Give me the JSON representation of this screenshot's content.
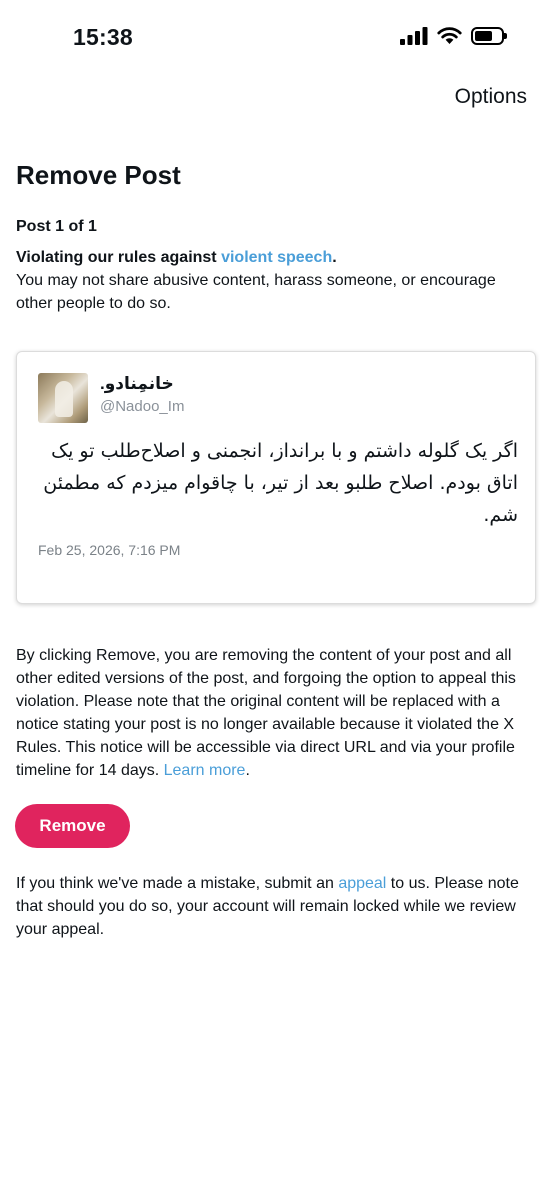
{
  "status_bar": {
    "time": "15:38"
  },
  "header": {
    "options_label": "Options"
  },
  "page": {
    "title": "Remove Post",
    "post_count": "Post 1 of 1",
    "violation_prefix": "Violating our rules against ",
    "violation_link": "violent speech",
    "violation_suffix": ".",
    "violation_desc": "You may not share abusive content, harass someone, or encourage other people to do so."
  },
  "tweet": {
    "author_name": "خانمِنادو.",
    "author_handle": "@Nadoo_Im",
    "text": "اگر یک گلوله داشتم و با برانداز، انجمنی و اصلاح‌طلب تو یک اتاق بودم. اصلاح طلبو بعد از تیر، با چاقوام میزدم که مطمئن شم.",
    "date": "Feb 25, 2026, 7:16 PM"
  },
  "removal": {
    "text": "By clicking Remove, you are removing the content of your post and all other edited versions of the post, and forgoing the option to appeal this violation. Please note that the original content will be replaced with a notice stating your post is no longer available because it violated the X Rules. This notice will be accessible via direct URL and via your profile timeline for 14 days. ",
    "learn_more": "Learn more",
    "learn_more_suffix": "."
  },
  "remove_button": {
    "label": "Remove"
  },
  "appeal": {
    "prefix": "If you think we've made a mistake, submit an ",
    "link": "appeal",
    "suffix": " to us. Please note that should you do so, your account will remain locked while we review your appeal."
  },
  "colors": {
    "link": "#4a9ed8",
    "remove_button": "#e0245e"
  },
  "icons": [
    "signal-icon",
    "wifi-icon",
    "battery-icon"
  ]
}
